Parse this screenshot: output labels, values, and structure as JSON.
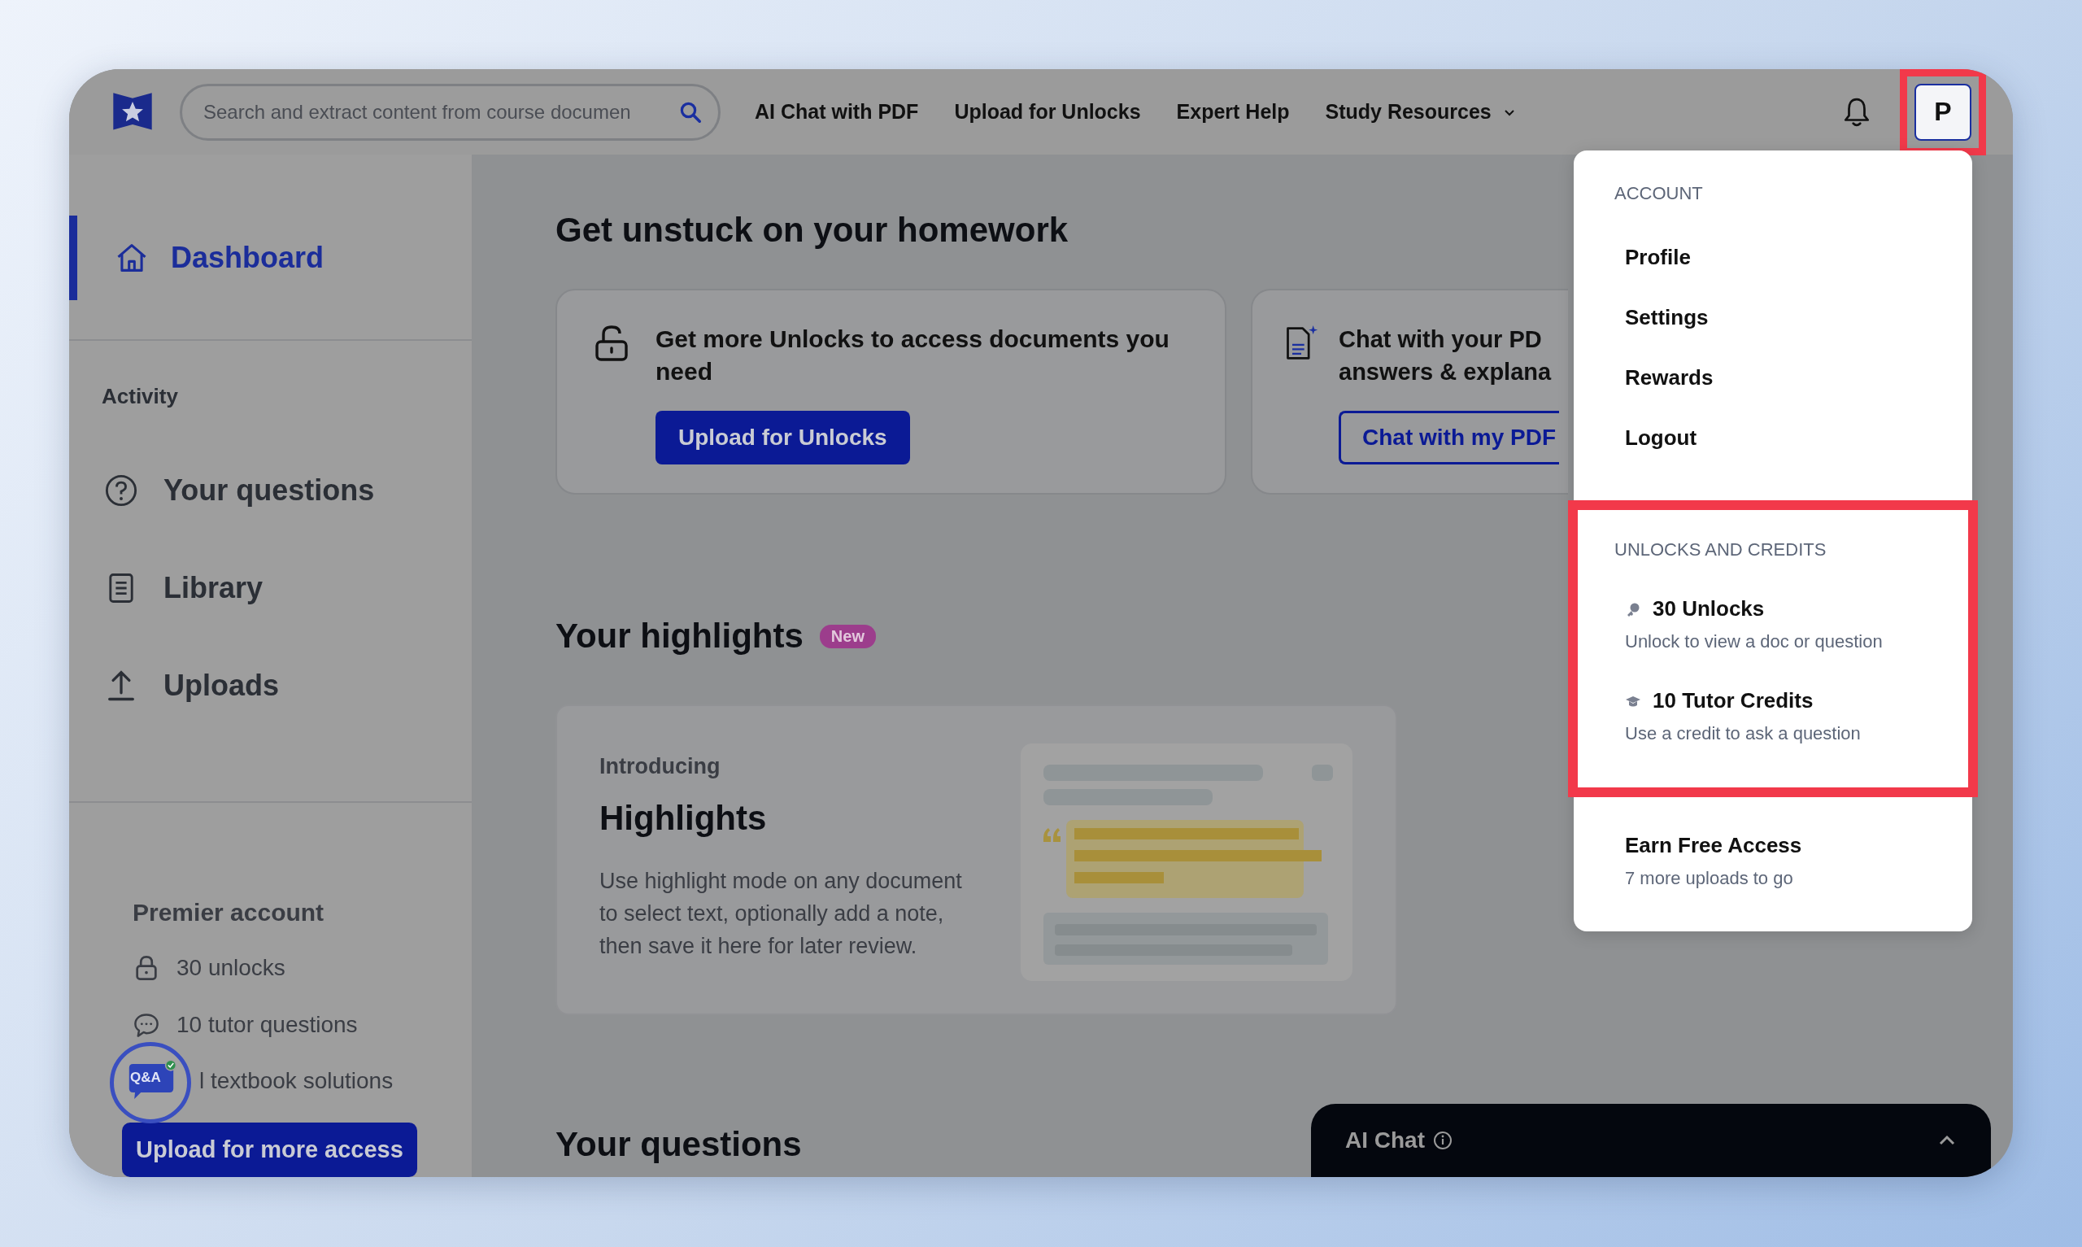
{
  "top_bar": {
    "search": {
      "placeholder": "Search and extract content from course documen"
    },
    "nav": [
      {
        "label": "AI Chat with PDF",
        "dropdown": false
      },
      {
        "label": "Upload for Unlocks",
        "dropdown": false
      },
      {
        "label": "Expert Help",
        "dropdown": false
      },
      {
        "label": "Study Resources",
        "dropdown": true
      }
    ],
    "avatar": {
      "initial": "P",
      "highlighted": true
    }
  },
  "sidebar": {
    "dashboard": {
      "label": "Dashboard",
      "selected": true
    },
    "activity_heading": "Activity",
    "items": [
      {
        "label": "Your questions",
        "selected": false
      },
      {
        "label": "Library",
        "selected": false
      },
      {
        "label": "Uploads",
        "selected": false
      }
    ],
    "premier": {
      "title": "Premier account",
      "features": [
        "30 unlocks",
        "10 tutor questions",
        "l textbook solutions"
      ]
    },
    "upload_button": "Upload for more access",
    "qa_badge": {
      "label": "Q&A",
      "verified": true
    }
  },
  "main": {
    "heading": "Get unstuck on your homework",
    "cards": [
      {
        "title_lines": [
          "Get more Unlocks to access documents you",
          "need"
        ],
        "button": {
          "label": "Upload for Unlocks",
          "kind": "primary"
        }
      },
      {
        "title_lines": [
          "Chat with your PD",
          "answers & explana"
        ],
        "button": {
          "label": "Chat with my PDF",
          "kind": "outline"
        }
      }
    ],
    "highlights": {
      "heading": "Your highlights",
      "badge": "New",
      "card": {
        "eyebrow": "Introducing",
        "title": "Highlights",
        "text": "Use highlight mode on any document to select text, optionally add a note, then save it here for later review."
      }
    },
    "questions_heading": "Your questions"
  },
  "account_menu": {
    "sections": [
      {
        "heading": "ACCOUNT",
        "highlighted": false,
        "items": [
          {
            "kind": "link",
            "label": "Profile"
          },
          {
            "kind": "link",
            "label": "Settings"
          },
          {
            "kind": "link",
            "label": "Rewards"
          },
          {
            "kind": "link",
            "label": "Logout"
          }
        ]
      },
      {
        "heading": "UNLOCKS AND CREDITS",
        "highlighted": true,
        "items": [
          {
            "kind": "credit",
            "label": "30 Unlocks",
            "subtitle": "Unlock to view a doc or question"
          },
          {
            "kind": "credit",
            "label": "10 Tutor Credits",
            "subtitle": "Use a credit to ask a question"
          }
        ]
      },
      {
        "highlighted": false,
        "items": [
          {
            "kind": "promo",
            "label": "Earn Free Access",
            "subtitle": "7 more uploads to go"
          }
        ]
      }
    ]
  },
  "ai_chat": {
    "title": "AI Chat",
    "expanded": false
  }
}
